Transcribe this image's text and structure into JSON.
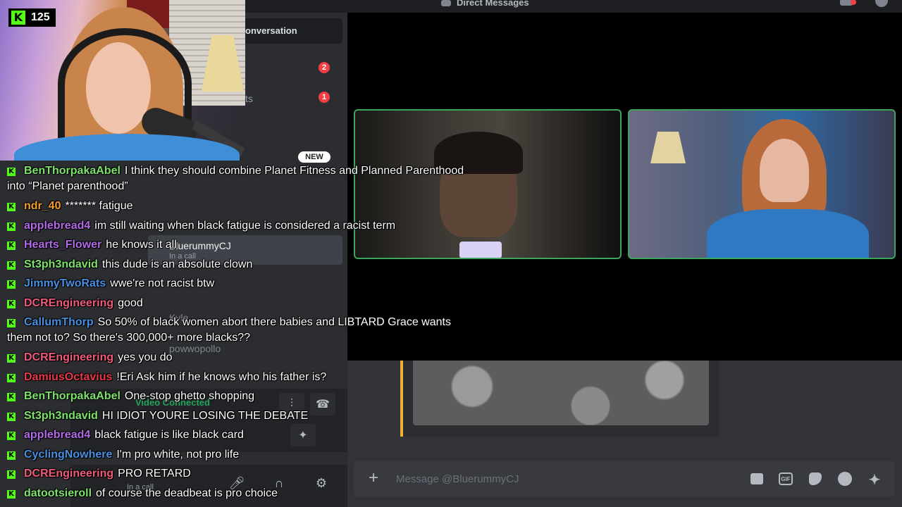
{
  "titlebar": {
    "title": "Direct Messages"
  },
  "dm_sidebar": {
    "find_placeholder_visible": "onversation",
    "rows": [
      {
        "label": "",
        "badge": "2"
      },
      {
        "label": "ts",
        "badge": "1"
      }
    ],
    "new_badge": "NEW",
    "users": [
      {
        "name": "BluerummyCJ",
        "status": "In a call"
      },
      {
        "name": "Kyle",
        "status": ""
      },
      {
        "name": "powwopollo",
        "status": ""
      }
    ],
    "voice_title": "Video Connected",
    "user_panel_status": "In a call"
  },
  "overlay": {
    "viewer_count": "125",
    "badge_glyph": "K"
  },
  "chat": [
    {
      "user": "BenThorpakaAbel",
      "color": "#7ee36b",
      "text": "I think they should combine Planet Fitness and Planned Parenthood into “Planet parenthood”"
    },
    {
      "user": "ndr_40",
      "color": "#f0a030",
      "text": "******* fatigue"
    },
    {
      "user": "applebread4",
      "color": "#b46be8",
      "text": "im still waiting when black fatigue is considered a racist term"
    },
    {
      "user": "Hearts_Flower",
      "color": "#b46be8",
      "text": "he knows it all"
    },
    {
      "user": "St3ph3ndavid",
      "color": "#7ee36b",
      "text": "this dude is an absolute clown"
    },
    {
      "user": "JimmyTwoRats",
      "color": "#4a90e2",
      "text": "wwe're not racist btw"
    },
    {
      "user": "DCREngineering",
      "color": "#ef5b7a",
      "text": "good"
    },
    {
      "user": "CallumThorp",
      "color": "#4a90e2",
      "text": "So 50% of black women abort there babies and LIBTARD Grace wants them not to? So there's 300,000+ more blacks??"
    },
    {
      "user": "DCREngineering",
      "color": "#ef5b7a",
      "text": "yes you do"
    },
    {
      "user": "DamiusOctavius",
      "color": "#e8394a",
      "text": "!Eri Ask him if he knows who his father is?"
    },
    {
      "user": "BenThorpakaAbel",
      "color": "#7ee36b",
      "text": "One-stop ghetto shopping"
    },
    {
      "user": "St3ph3ndavid",
      "color": "#7ee36b",
      "text": "HI IDIOT YOURE LOSING THE DEBATE"
    },
    {
      "user": "applebread4",
      "color": "#b46be8",
      "text": "black fatigue is like black card"
    },
    {
      "user": "CyclingNowhere",
      "color": "#4a90e2",
      "text": "I'm pro white, not pro life"
    },
    {
      "user": "DCREngineering",
      "color": "#ef5b7a",
      "text": "PRO RETARD"
    },
    {
      "user": "datootsieroll",
      "color": "#7ee36b",
      "text": "of course the deadbeat is pro choice"
    }
  ],
  "composer": {
    "placeholder": "Message @BluerummyCJ",
    "gif_label": "GIF"
  },
  "icons": {
    "add": "circle-plus-icon",
    "gift": "gift-icon",
    "gif": "gif-icon",
    "sticker": "sticker-icon",
    "emoji": "emoji-icon",
    "apps": "apps-icon"
  }
}
